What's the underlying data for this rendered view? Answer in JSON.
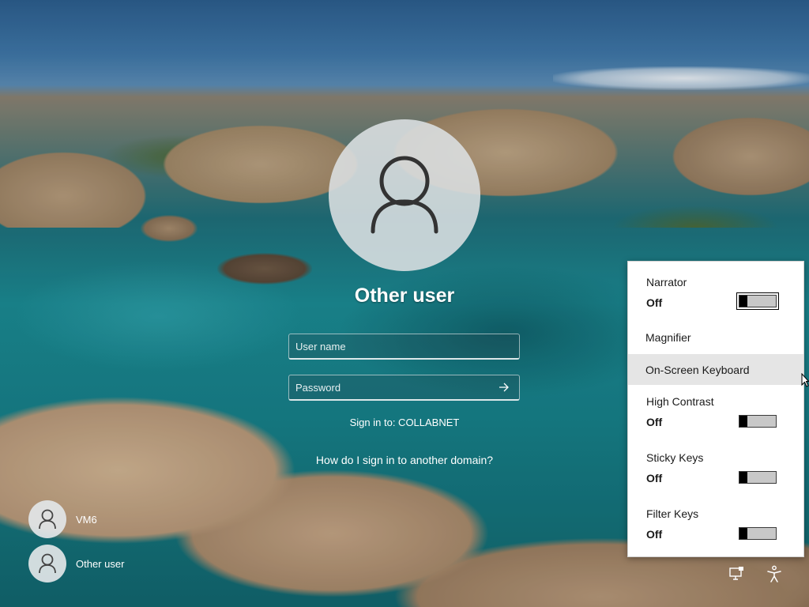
{
  "login": {
    "user_title": "Other user",
    "username_placeholder": "User name",
    "password_placeholder": "Password",
    "submit_icon": "arrow-right-icon",
    "sign_in_to": "Sign in to: COLLABNET",
    "domain_link": "How do I sign in to another domain?"
  },
  "users": [
    {
      "name": "VM6"
    },
    {
      "name": "Other user"
    }
  ],
  "accessibility": {
    "narrator": {
      "label": "Narrator",
      "state": "Off"
    },
    "magnifier": {
      "label": "Magnifier"
    },
    "onscreen_keyboard": {
      "label": "On-Screen Keyboard"
    },
    "high_contrast": {
      "label": "High Contrast",
      "state": "Off"
    },
    "sticky_keys": {
      "label": "Sticky Keys",
      "state": "Off"
    },
    "filter_keys": {
      "label": "Filter Keys",
      "state": "Off"
    }
  },
  "icons": {
    "network": "network-icon",
    "accessibility": "accessibility-icon"
  },
  "colors": {
    "flyout_bg": "#ffffff",
    "hover_bg": "#e5e5e5",
    "toggle_off": "#c8c8c8"
  }
}
